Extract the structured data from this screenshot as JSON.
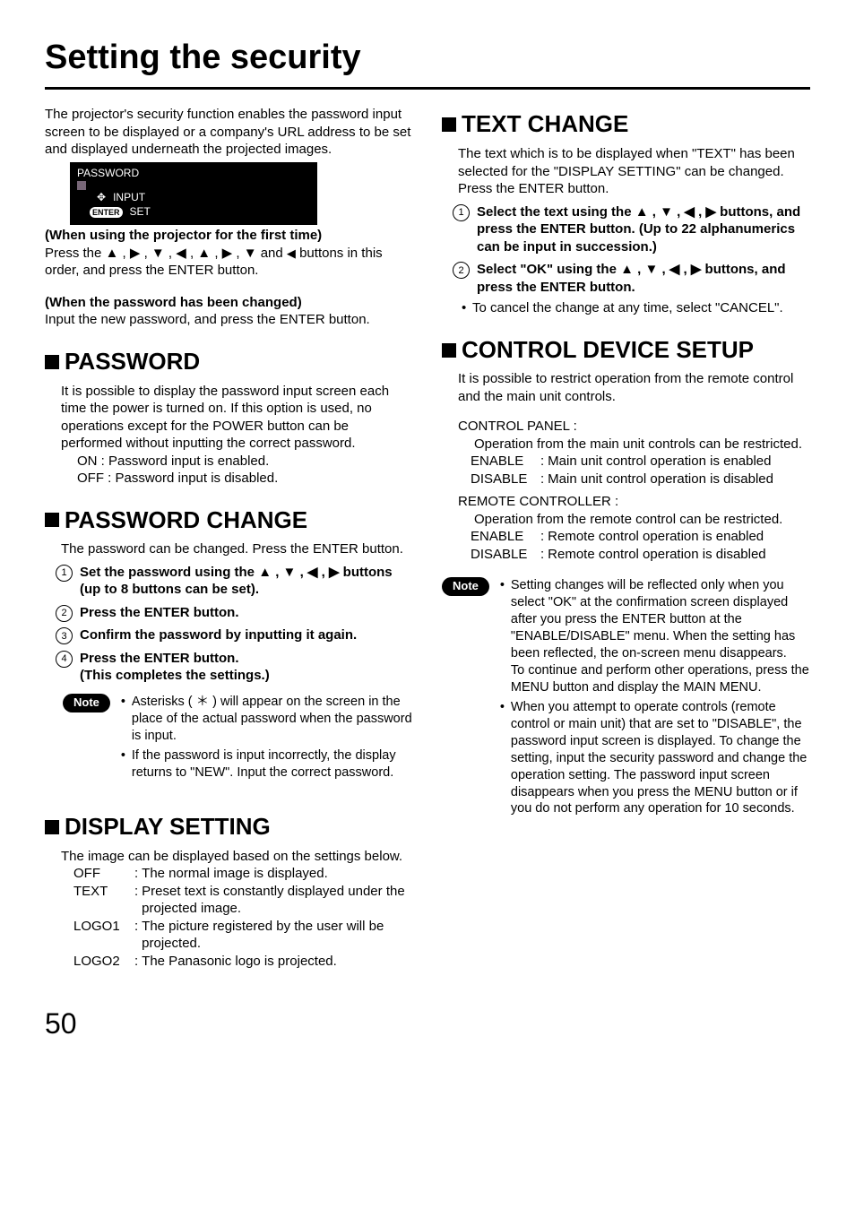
{
  "page_title": "Setting the security",
  "page_number": "50",
  "intro": "The projector's security function enables the password input screen to be displayed or a company's URL address to be set and displayed underneath the projected images.",
  "osd": {
    "title": "PASSWORD",
    "input": "INPUT",
    "set": "SET",
    "enter": "ENTER"
  },
  "first_time_heading": "(When using the projector for the first time)",
  "first_time_line_a": "Press the ",
  "first_time_line_b": " and ",
  "first_time_line_c": " buttons in this order, and press the ENTER button.",
  "changed_heading": "(When the password has been changed)",
  "changed_body": "Input the new password, and press the ENTER button.",
  "password": {
    "heading": "PASSWORD",
    "body": "It is possible to display the password input screen each time the power is turned on. If this option is used, no operations except for the POWER button can be performed without inputting the correct password.",
    "on": "ON   : Password input is enabled.",
    "off": "OFF : Password input is disabled."
  },
  "password_change": {
    "heading": "PASSWORD CHANGE",
    "body": "The password can be changed. Press the ENTER button.",
    "step1_a": "Set the password using the ",
    "step1_b": " buttons (up to 8 buttons can be set).",
    "step2": "Press the ENTER button.",
    "step3": "Confirm the password by inputting it again.",
    "step4a": "Press the ENTER button.",
    "step4b": "(This completes the settings.)",
    "note1": "Asterisks ( ＊ ) will appear on the screen in the place of the actual password when the password is input.",
    "note2": "If the password is input incorrectly, the display returns to \"NEW\". Input the correct password."
  },
  "display_setting": {
    "heading": "DISPLAY SETTING",
    "body": "The image can be displayed based on the settings below.",
    "off_k": "OFF",
    "off_v": "The normal image is displayed.",
    "text_k": "TEXT",
    "text_v": "Preset text is constantly displayed under the projected image.",
    "logo1_k": "LOGO1",
    "logo1_v": "The picture registered by the user will be projected.",
    "logo2_k": "LOGO2",
    "logo2_v": "The Panasonic logo is projected."
  },
  "text_change": {
    "heading": "TEXT CHANGE",
    "body": "The text which is to be displayed when \"TEXT\" has been selected for the \"DISPLAY SETTING\" can be changed. Press the ENTER button.",
    "step1_a": "Select the text using the ",
    "step1_b": " buttons, and press the ENTER button. (Up to 22 alphanumerics can be input in succession.)",
    "step2_a": "Select \"OK\" using the  ",
    "step2_b": " buttons, and press the ENTER button.",
    "cancel": "To cancel the change at any time, select \"CANCEL\"."
  },
  "control_device": {
    "heading": "CONTROL DEVICE SETUP",
    "body": "It is possible to restrict operation from the remote control and the main unit controls.",
    "cp_h": "CONTROL PANEL :",
    "cp_b": "Operation from the main unit controls can be restricted.",
    "cp_en_k": "ENABLE",
    "cp_en_v": "Main unit control operation is enabled",
    "cp_dis_k": "DISABLE",
    "cp_dis_v": "Main unit control operation is disabled",
    "rc_h": "REMOTE CONTROLLER :",
    "rc_b": "Operation from the remote control can be restricted.",
    "rc_en_k": "ENABLE",
    "rc_en_v": "Remote control operation is enabled",
    "rc_dis_k": "DISABLE",
    "rc_dis_v": "Remote control operation is disabled",
    "note1a": "Setting changes will be reflected only when you select \"OK\" at the confirmation screen displayed after you press the ENTER button at the \"ENABLE/DISABLE\" menu. When the setting has been reflected, the on-screen menu disappears.",
    "note1b": "To continue and perform other operations, press the MENU button and display the MAIN MENU.",
    "note2": "When you attempt to operate controls (remote control or main unit) that are set to \"DISABLE\", the password input screen is displayed. To change the setting, input the security password and change the operation setting. The password input screen disappears when you press the MENU button or if you do not perform any operation for 10 seconds."
  },
  "note_label": "Note"
}
